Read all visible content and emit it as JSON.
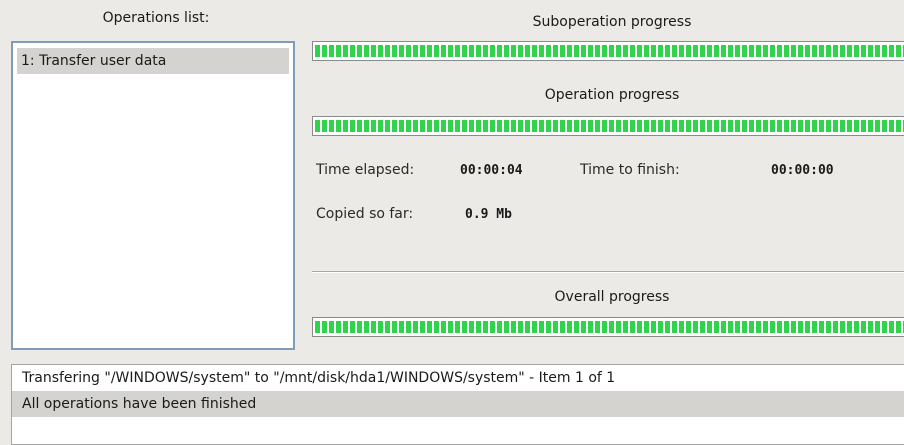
{
  "operations": {
    "header": "Operations list:",
    "items": [
      {
        "label": "1: Transfer user data"
      }
    ]
  },
  "suboperation": {
    "title": "Suboperation progress",
    "progress": 1.0
  },
  "operation": {
    "title": "Operation progress",
    "progress": 1.0
  },
  "stats": {
    "time_elapsed_label": "Time elapsed:",
    "time_elapsed_value": "00:00:04",
    "time_to_finish_label": "Time to finish:",
    "time_to_finish_value": "00:00:00",
    "copied_label": "Copied so far:",
    "copied_value": "0.9 Mb"
  },
  "overall": {
    "title": "Overall progress",
    "progress": 1.0
  },
  "log": {
    "lines": [
      "Transfering \"/WINDOWS/system\" to \"/mnt/disk/hda1/WINDOWS/system\" - Item 1 of 1",
      "All operations have been finished"
    ]
  },
  "colors": {
    "progress_fill": "#2fd44a",
    "selection": "#d4d3cf",
    "list_border": "#7f9db9"
  }
}
